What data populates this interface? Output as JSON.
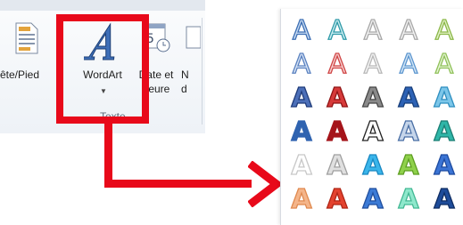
{
  "ribbon": {
    "buttons": {
      "header_footer": "ête/Pied",
      "wordart": "WordArt",
      "datetime_line1": "Date et",
      "datetime_line2": "heure",
      "next_line1": "N",
      "next_line2": "d"
    },
    "group_label": "Texte",
    "highlight_color": "#e8091a"
  },
  "wordart_gallery": {
    "letter": "A",
    "styles": [
      [
        {
          "name": "blue-outline",
          "fill": "#c9dcf2",
          "stroke": "#3d6fb4"
        },
        {
          "name": "teal-outline",
          "fill": "#cdeef2",
          "stroke": "#2f9aa8"
        },
        {
          "name": "gray-outline",
          "fill": "#f4f4f4",
          "stroke": "#a8a8a8"
        },
        {
          "name": "gray-outline-2",
          "fill": "#f4f4f4",
          "stroke": "#a8a8a8"
        },
        {
          "name": "green-outline",
          "fill": "#e3f2c8",
          "stroke": "#8cb84a"
        }
      ],
      [
        {
          "name": "blue-light",
          "fill": "#d6e3f5",
          "stroke": "#5b82c0"
        },
        {
          "name": "red-light",
          "fill": "#f6d3d3",
          "stroke": "#d04545"
        },
        {
          "name": "gray-light",
          "fill": "#f6f6f6",
          "stroke": "#b8b8b8"
        },
        {
          "name": "blue-light-2",
          "fill": "#d5e7f6",
          "stroke": "#5d96cf"
        },
        {
          "name": "green-light",
          "fill": "#e6f5d6",
          "stroke": "#90c15a"
        }
      ],
      [
        {
          "name": "navy-fill",
          "fill": "#4c6fb8",
          "stroke": "#1f3b7a"
        },
        {
          "name": "red-fill",
          "fill": "#d63a3a",
          "stroke": "#8f1414"
        },
        {
          "name": "gray-fill",
          "fill": "#8a8a8a",
          "stroke": "#474747"
        },
        {
          "name": "blue-fill",
          "fill": "#2d62b5",
          "stroke": "#173e7a"
        },
        {
          "name": "cyan-fill",
          "fill": "#7cc6e9",
          "stroke": "#2f8fc0"
        }
      ],
      [
        {
          "name": "blue-solid",
          "fill": "#2f63b0",
          "stroke": "#2f63b0"
        },
        {
          "name": "darkred-solid",
          "fill": "#a5141a",
          "stroke": "#a5141a"
        },
        {
          "name": "black-outline",
          "fill": "#ffffff",
          "stroke": "#222222"
        },
        {
          "name": "steel-outline",
          "fill": "#c5d5ea",
          "stroke": "#4a6fa5"
        },
        {
          "name": "teal-gradient",
          "fill": "#2fb6a8",
          "stroke": "#1b7e74"
        }
      ],
      [
        {
          "name": "faint-gray",
          "fill": "#ffffff",
          "stroke": "#c8c8c8"
        },
        {
          "name": "silver",
          "fill": "#e0e0e0",
          "stroke": "#a0a0a0"
        },
        {
          "name": "sky-blue",
          "fill": "#3ab5ea",
          "stroke": "#1a88c2"
        },
        {
          "name": "lime",
          "fill": "#8fd14b",
          "stroke": "#5e9e22"
        },
        {
          "name": "royal-blue",
          "fill": "#3b74d4",
          "stroke": "#1d4ba0"
        }
      ],
      [
        {
          "name": "peach",
          "fill": "#f4b58a",
          "stroke": "#e08a50"
        },
        {
          "name": "red-orange",
          "fill": "#e4432f",
          "stroke": "#b02616"
        },
        {
          "name": "blue-bold",
          "fill": "#3c7bd6",
          "stroke": "#214f9e"
        },
        {
          "name": "mint",
          "fill": "#8fe8cc",
          "stroke": "#43b894"
        },
        {
          "name": "navy-bold",
          "fill": "#1e4c9a",
          "stroke": "#0f2d63"
        }
      ]
    ]
  }
}
